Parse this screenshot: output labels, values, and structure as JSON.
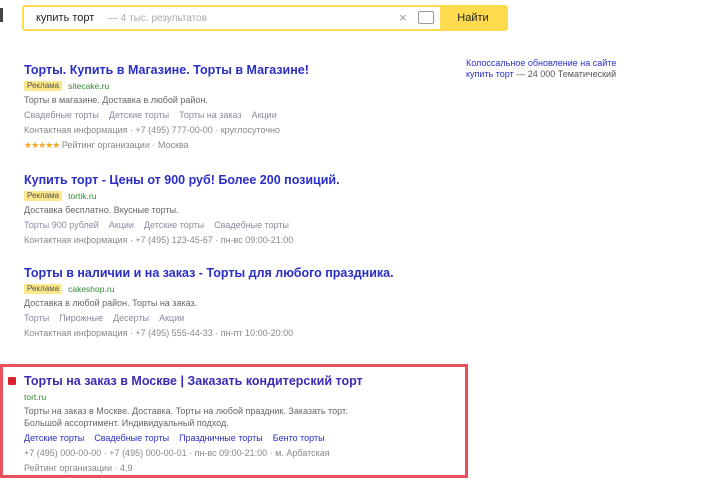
{
  "search": {
    "query": "купить торт",
    "hint": "— 4 тыс. результатов",
    "button": "Найти"
  },
  "right_ad": {
    "line1": "Колоссальное обновление на сайте",
    "line2": "купить торт",
    "line3": "— 24 000 Тематический"
  },
  "results": [
    {
      "title": "Торты. Купить в Магазине. Торты в Магазине!",
      "badge": "Реклама",
      "url": "sitecake.ru",
      "desc": "Торты в магазине. Доставка в любой район.",
      "links": [
        "Свадебные торты",
        "Детские торты",
        "Торты на заказ",
        "Акции"
      ],
      "meta": "Контактная информация · +7 (495) 777-00-00 · круглосуточно",
      "rating": "Рейтинг организации · Москва"
    },
    {
      "title": "Купить торт - Цены от 900 руб! Более 200 позиций.",
      "badge": "Реклама",
      "url": "tortik.ru",
      "desc": "Доставка бесплатно. Вкусные торты.",
      "links": [
        "Торты 900 рублей",
        "Акции",
        "Детские торты",
        "Свадебные торты"
      ],
      "meta": "Контактная информация · +7 (495) 123-45-67 · пн-вс 09:00-21:00"
    },
    {
      "title": "Торты в наличии и на заказ - Торты для любого праздника.",
      "badge": "Реклама",
      "url": "cakeshop.ru",
      "desc": "Доставка в любой район. Торты на заказ.",
      "links": [
        "Торты",
        "Пирожные",
        "Десерты",
        "Акции"
      ],
      "meta": "Контактная информация · +7 (495) 555-44-33 · пн-пт 10:00-20:00"
    },
    {
      "title": "Торты на заказ в Москве | Заказать кондитерский торт",
      "url": "tort.ru",
      "desc1": "Торты на заказ в Москве. Доставка. Торты на любой праздник. Заказать торт.",
      "desc2": "Большой ассортимент. Индивидуальный подход.",
      "links": [
        "Детские торты",
        "Свадебные торты",
        "Праздничные торты",
        "Бенто торты"
      ],
      "meta": "+7 (495) 000-00-00 · +7 (495) 000-00-01 · пн-вс 09:00-21:00 · м. Арбатская",
      "reviews": "Рейтинг организации · 4,9"
    }
  ]
}
